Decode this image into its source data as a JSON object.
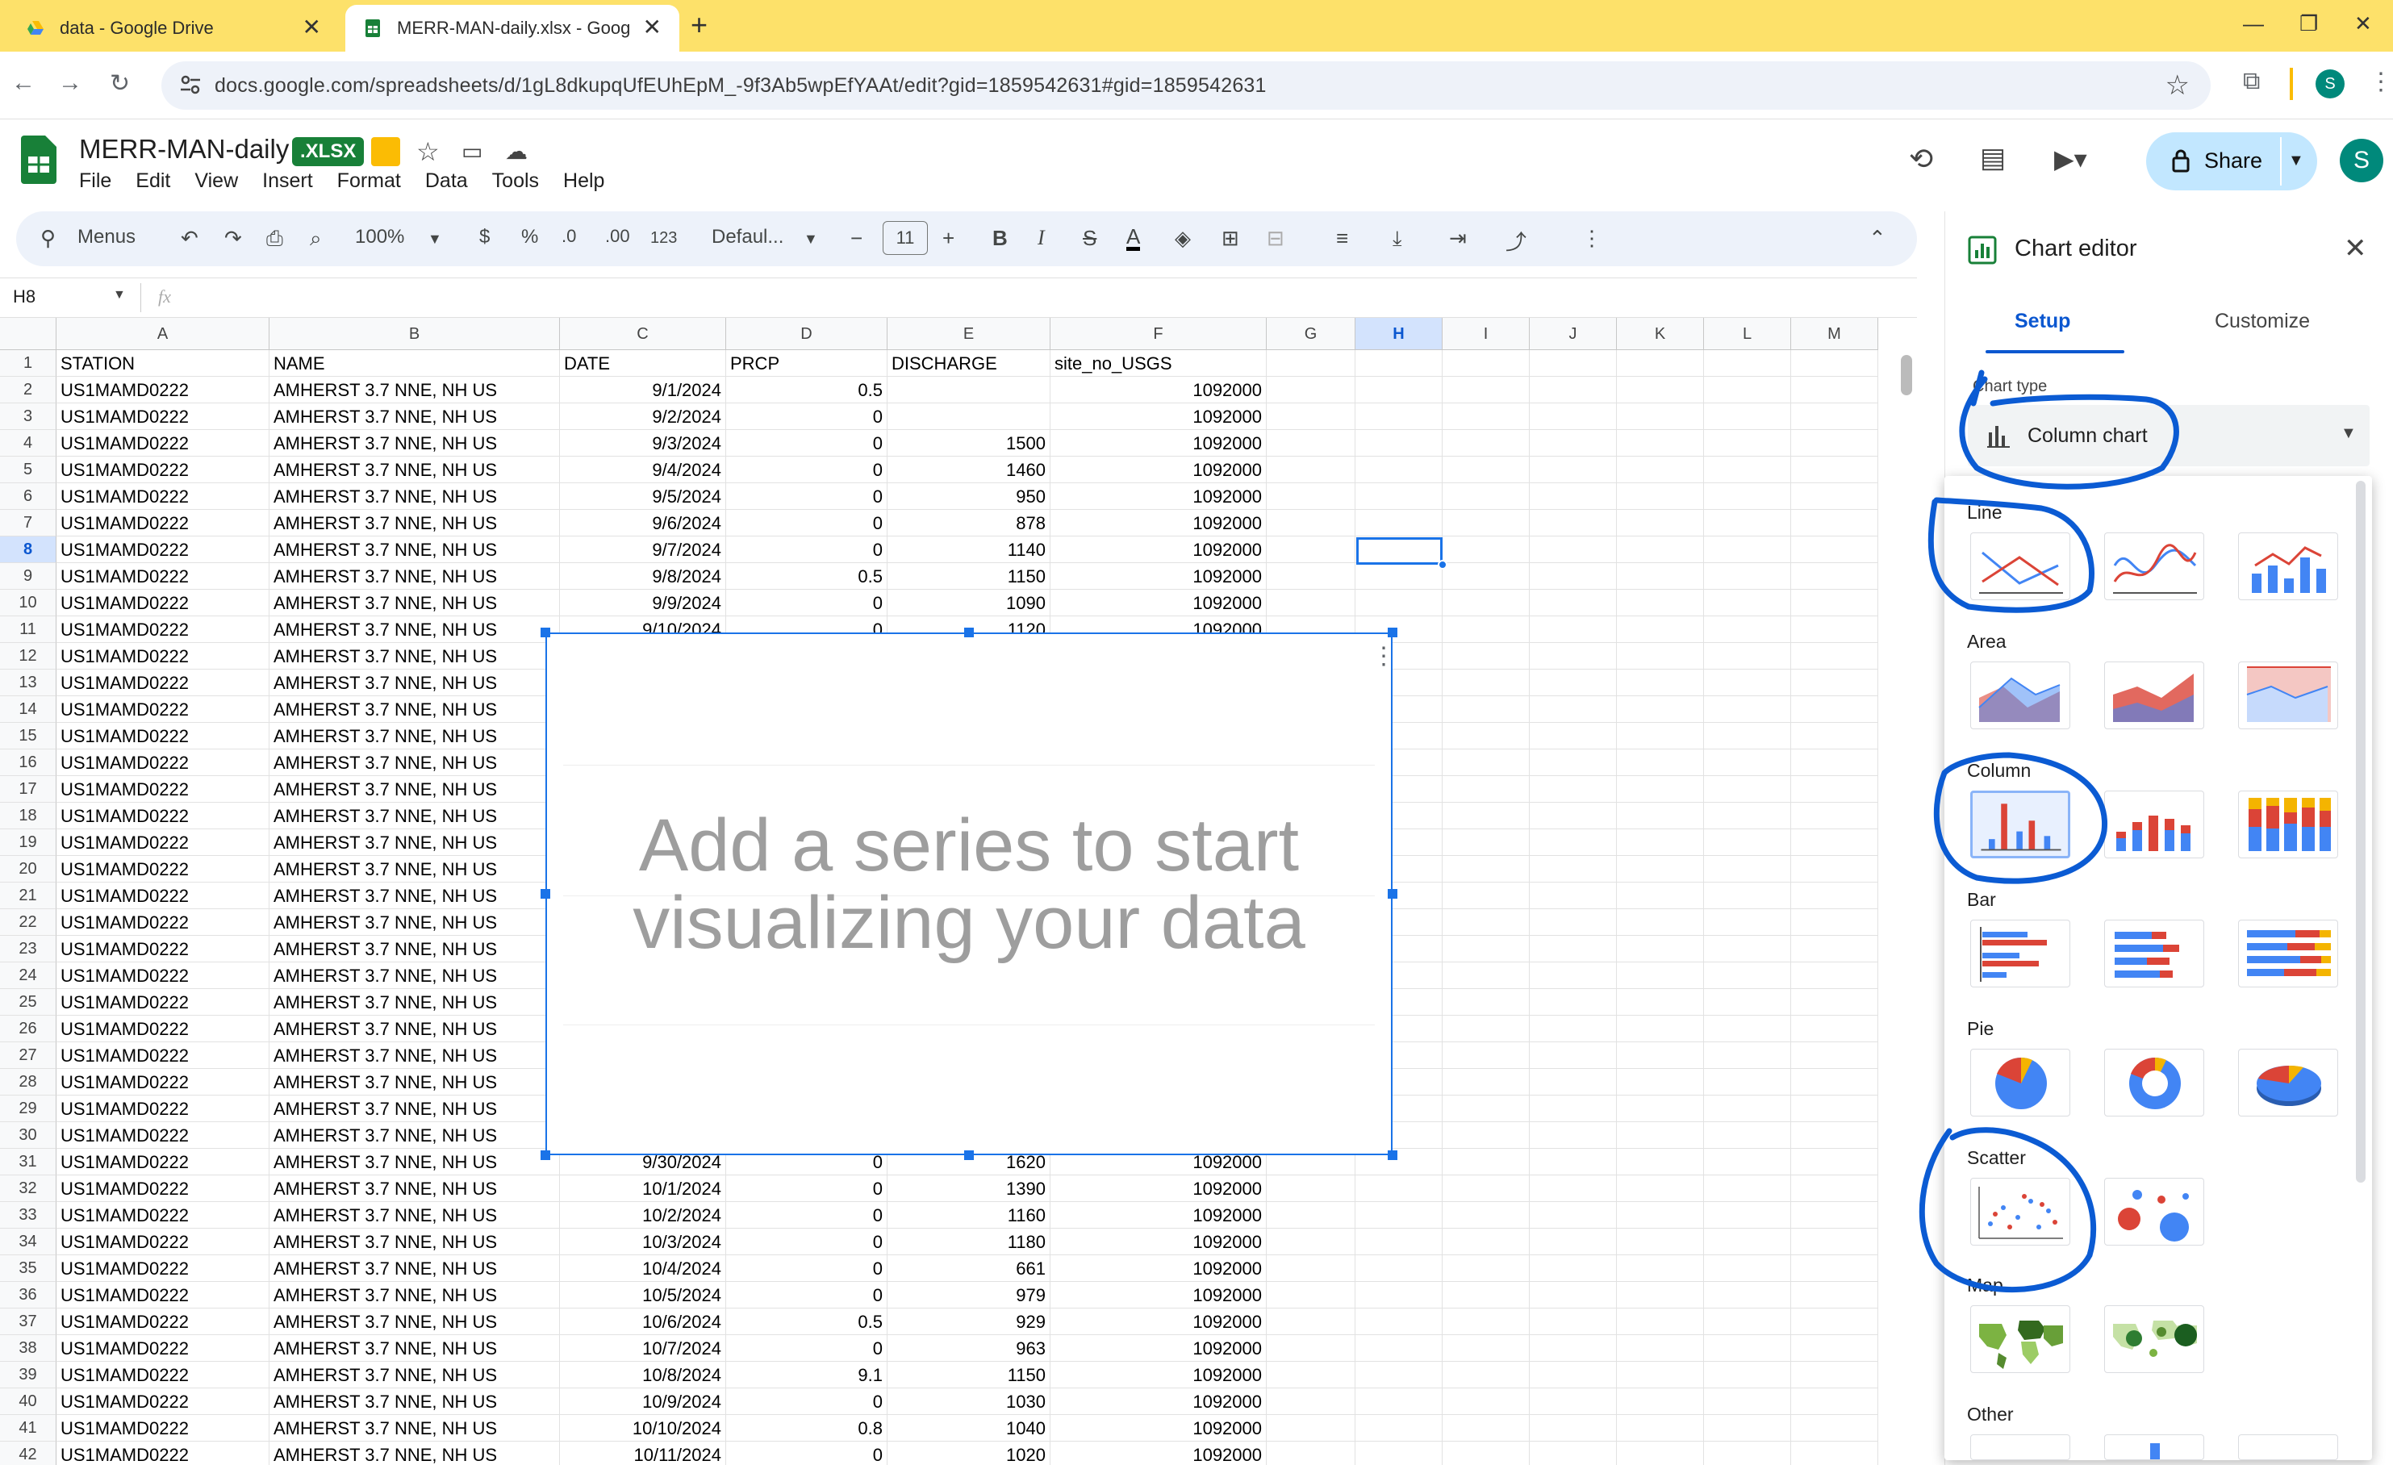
{
  "browser": {
    "tabs": [
      {
        "title": "data - Google Drive",
        "favicon": "google-drive-icon"
      },
      {
        "title": "MERR-MAN-daily.xlsx - Google",
        "favicon": "google-sheets-icon"
      }
    ],
    "url": "docs.google.com/spreadsheets/d/1gL8dkupqUfEUhEpM_-9f3Ab5wpEfYAAt/edit?gid=1859542631#gid=1859542631",
    "profile_initial": "S"
  },
  "doc": {
    "title": "MERR-MAN-daily",
    "badge": ".XLSX",
    "menus": [
      "File",
      "Edit",
      "View",
      "Insert",
      "Format",
      "Data",
      "Tools",
      "Help"
    ],
    "share_label": "Share",
    "avatar_initial": "S"
  },
  "toolbar": {
    "menus_label": "Menus",
    "zoom": "100%",
    "currency": "$",
    "percent": "%",
    "dec_decrease": ".0",
    "dec_increase": ".00",
    "number_format": "123",
    "font": "Defaul...",
    "font_size": "11",
    "bold": "B",
    "italic": "I",
    "strike": "S",
    "text_color": "A"
  },
  "formula_bar": {
    "cell_ref": "H8",
    "fx": "fx"
  },
  "sheet": {
    "columns": [
      "A",
      "B",
      "C",
      "D",
      "E",
      "F",
      "G",
      "H",
      "I",
      "J",
      "K",
      "L",
      "M"
    ],
    "selected_column": "H",
    "selected_row": "8",
    "header_row": [
      "STATION",
      "NAME",
      "DATE",
      "PRCP",
      "DISCHARGE",
      "site_no_USGS"
    ],
    "rows": [
      [
        "2",
        "US1MAMD0222",
        "AMHERST 3.7 NNE, NH US",
        "9/1/2024",
        "0.5",
        "",
        "1092000"
      ],
      [
        "3",
        "US1MAMD0222",
        "AMHERST 3.7 NNE, NH US",
        "9/2/2024",
        "0",
        "",
        "1092000"
      ],
      [
        "4",
        "US1MAMD0222",
        "AMHERST 3.7 NNE, NH US",
        "9/3/2024",
        "0",
        "1500",
        "1092000"
      ],
      [
        "5",
        "US1MAMD0222",
        "AMHERST 3.7 NNE, NH US",
        "9/4/2024",
        "0",
        "1460",
        "1092000"
      ],
      [
        "6",
        "US1MAMD0222",
        "AMHERST 3.7 NNE, NH US",
        "9/5/2024",
        "0",
        "950",
        "1092000"
      ],
      [
        "7",
        "US1MAMD0222",
        "AMHERST 3.7 NNE, NH US",
        "9/6/2024",
        "0",
        "878",
        "1092000"
      ],
      [
        "8",
        "US1MAMD0222",
        "AMHERST 3.7 NNE, NH US",
        "9/7/2024",
        "0",
        "1140",
        "1092000"
      ],
      [
        "9",
        "US1MAMD0222",
        "AMHERST 3.7 NNE, NH US",
        "9/8/2024",
        "0.5",
        "1150",
        "1092000"
      ],
      [
        "10",
        "US1MAMD0222",
        "AMHERST 3.7 NNE, NH US",
        "9/9/2024",
        "0",
        "1090",
        "1092000"
      ],
      [
        "11",
        "US1MAMD0222",
        "AMHERST 3.7 NNE, NH US",
        "9/10/2024",
        "0",
        "1120",
        "1092000"
      ],
      [
        "12",
        "US1MAMD0222",
        "AMHERST 3.7 NNE, NH US",
        "",
        "",
        "",
        ""
      ],
      [
        "13",
        "US1MAMD0222",
        "AMHERST 3.7 NNE, NH US",
        "",
        "",
        "",
        ""
      ],
      [
        "14",
        "US1MAMD0222",
        "AMHERST 3.7 NNE, NH US",
        "",
        "",
        "",
        ""
      ],
      [
        "15",
        "US1MAMD0222",
        "AMHERST 3.7 NNE, NH US",
        "",
        "",
        "",
        ""
      ],
      [
        "16",
        "US1MAMD0222",
        "AMHERST 3.7 NNE, NH US",
        "",
        "",
        "",
        ""
      ],
      [
        "17",
        "US1MAMD0222",
        "AMHERST 3.7 NNE, NH US",
        "",
        "",
        "",
        ""
      ],
      [
        "18",
        "US1MAMD0222",
        "AMHERST 3.7 NNE, NH US",
        "",
        "",
        "",
        ""
      ],
      [
        "19",
        "US1MAMD0222",
        "AMHERST 3.7 NNE, NH US",
        "",
        "",
        "",
        ""
      ],
      [
        "20",
        "US1MAMD0222",
        "AMHERST 3.7 NNE, NH US",
        "",
        "",
        "",
        ""
      ],
      [
        "21",
        "US1MAMD0222",
        "AMHERST 3.7 NNE, NH US",
        "",
        "",
        "",
        ""
      ],
      [
        "22",
        "US1MAMD0222",
        "AMHERST 3.7 NNE, NH US",
        "",
        "",
        "",
        ""
      ],
      [
        "23",
        "US1MAMD0222",
        "AMHERST 3.7 NNE, NH US",
        "",
        "",
        "",
        ""
      ],
      [
        "24",
        "US1MAMD0222",
        "AMHERST 3.7 NNE, NH US",
        "",
        "",
        "",
        ""
      ],
      [
        "25",
        "US1MAMD0222",
        "AMHERST 3.7 NNE, NH US",
        "",
        "",
        "",
        ""
      ],
      [
        "26",
        "US1MAMD0222",
        "AMHERST 3.7 NNE, NH US",
        "",
        "",
        "",
        ""
      ],
      [
        "27",
        "US1MAMD0222",
        "AMHERST 3.7 NNE, NH US",
        "",
        "",
        "",
        ""
      ],
      [
        "28",
        "US1MAMD0222",
        "AMHERST 3.7 NNE, NH US",
        "",
        "",
        "",
        ""
      ],
      [
        "29",
        "US1MAMD0222",
        "AMHERST 3.7 NNE, NH US",
        "",
        "",
        "",
        ""
      ],
      [
        "30",
        "US1MAMD0222",
        "AMHERST 3.7 NNE, NH US",
        "",
        "",
        "",
        ""
      ],
      [
        "31",
        "US1MAMD0222",
        "AMHERST 3.7 NNE, NH US",
        "9/30/2024",
        "0",
        "1620",
        "1092000"
      ],
      [
        "32",
        "US1MAMD0222",
        "AMHERST 3.7 NNE, NH US",
        "10/1/2024",
        "0",
        "1390",
        "1092000"
      ],
      [
        "33",
        "US1MAMD0222",
        "AMHERST 3.7 NNE, NH US",
        "10/2/2024",
        "0",
        "1160",
        "1092000"
      ],
      [
        "34",
        "US1MAMD0222",
        "AMHERST 3.7 NNE, NH US",
        "10/3/2024",
        "0",
        "1180",
        "1092000"
      ],
      [
        "35",
        "US1MAMD0222",
        "AMHERST 3.7 NNE, NH US",
        "10/4/2024",
        "0",
        "661",
        "1092000"
      ],
      [
        "36",
        "US1MAMD0222",
        "AMHERST 3.7 NNE, NH US",
        "10/5/2024",
        "0",
        "979",
        "1092000"
      ],
      [
        "37",
        "US1MAMD0222",
        "AMHERST 3.7 NNE, NH US",
        "10/6/2024",
        "0.5",
        "929",
        "1092000"
      ],
      [
        "38",
        "US1MAMD0222",
        "AMHERST 3.7 NNE, NH US",
        "10/7/2024",
        "0",
        "963",
        "1092000"
      ],
      [
        "39",
        "US1MAMD0222",
        "AMHERST 3.7 NNE, NH US",
        "10/8/2024",
        "9.1",
        "1150",
        "1092000"
      ],
      [
        "40",
        "US1MAMD0222",
        "AMHERST 3.7 NNE, NH US",
        "10/9/2024",
        "0",
        "1030",
        "1092000"
      ],
      [
        "41",
        "US1MAMD0222",
        "AMHERST 3.7 NNE, NH US",
        "10/10/2024",
        "0.8",
        "1040",
        "1092000"
      ],
      [
        "42",
        "US1MAMD0222",
        "AMHERST 3.7 NNE, NH US",
        "10/11/2024",
        "0",
        "1020",
        "1092000"
      ]
    ]
  },
  "chart_placeholder": {
    "message": "Add a series to start visualizing your data"
  },
  "chart_editor": {
    "title": "Chart editor",
    "tabs": [
      "Setup",
      "Customize"
    ],
    "chart_type_label": "Chart type",
    "chart_type_value": "Column chart",
    "sections": [
      "Line",
      "Area",
      "Column",
      "Bar",
      "Pie",
      "Scatter",
      "Map",
      "Other"
    ]
  },
  "colors": {
    "accent": "#1a73e8",
    "annotation": "#0b5bd3",
    "tab_bar": "#fde16a",
    "sheets_green": "#188038"
  }
}
